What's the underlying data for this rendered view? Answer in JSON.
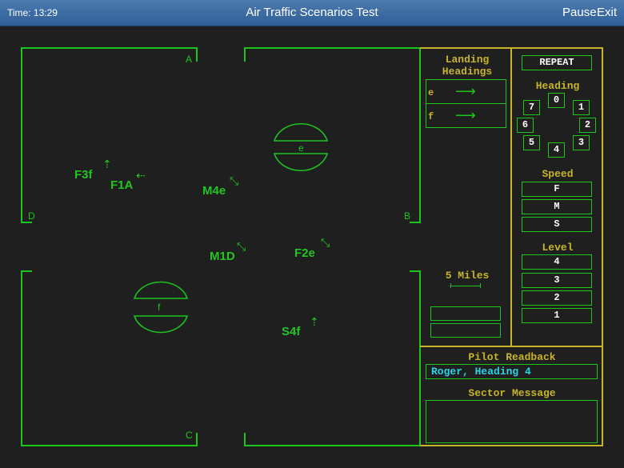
{
  "header": {
    "time": "Time: 13:29",
    "title": "Air Traffic Scenarios Test",
    "pause": "Pause",
    "exit": "Exit"
  },
  "corners": {
    "a": "A",
    "b": "B",
    "c": "C",
    "d": "D"
  },
  "airports": {
    "e": "e",
    "f": "f"
  },
  "aircraft": {
    "f3f": "F3f",
    "f1a": "F1A",
    "m4e": "M4e",
    "m1d": "M1D",
    "f2e": "F2e",
    "s4f": "S4f"
  },
  "landing": {
    "title_line1": "Landing",
    "title_line2": "Headings",
    "rows": [
      {
        "label": "e"
      },
      {
        "label": "f"
      }
    ]
  },
  "scale": {
    "label": "5 Miles"
  },
  "controls": {
    "repeat": "REPEAT",
    "heading_title": "Heading",
    "headings": [
      "0",
      "1",
      "2",
      "3",
      "4",
      "5",
      "6",
      "7"
    ],
    "speed_title": "Speed",
    "speeds": [
      "F",
      "M",
      "S"
    ],
    "level_title": "Level",
    "levels": [
      "4",
      "3",
      "2",
      "1"
    ]
  },
  "pilot": {
    "title": "Pilot Readback",
    "readback": "Roger, Heading 4"
  },
  "sector": {
    "title": "Sector Message",
    "message": ""
  },
  "colors": {
    "radar_green": "#1cc51c",
    "panel_yellow": "#c8b42a",
    "readback_cyan": "#2ad3e6",
    "header_blue": "#3a6aa3"
  }
}
